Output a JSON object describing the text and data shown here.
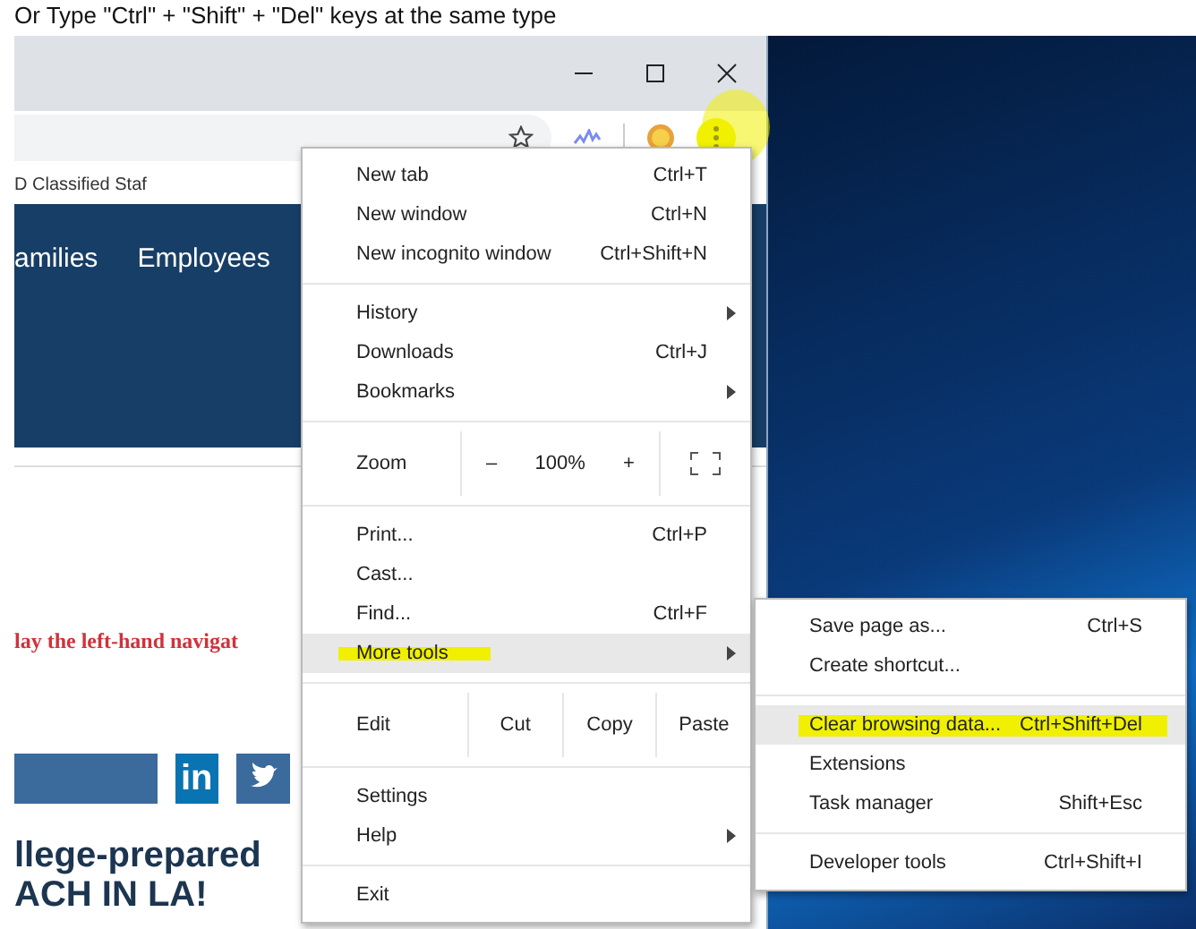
{
  "caption": "Or Type \"Ctrl\" + \"Shift\" + \"Del\" keys at the same type",
  "page": {
    "bookmark": "D Classified Staf",
    "nav": [
      "amilies",
      "Employees"
    ],
    "notice": "lay the left-hand navigat",
    "social": [
      "in"
    ],
    "heading": [
      "llege-prepared",
      "ACH IN LA!"
    ]
  },
  "menu": {
    "items": [
      {
        "kind": "item",
        "label": "New tab",
        "shortcut": "Ctrl+T",
        "submenu": false,
        "selected": false
      },
      {
        "kind": "item",
        "label": "New window",
        "shortcut": "Ctrl+N",
        "submenu": false,
        "selected": false
      },
      {
        "kind": "item",
        "label": "New incognito window",
        "shortcut": "Ctrl+Shift+N",
        "submenu": false,
        "selected": false
      },
      {
        "kind": "separator"
      },
      {
        "kind": "item",
        "label": "History",
        "submenu": true,
        "selected": false
      },
      {
        "kind": "item",
        "label": "Downloads",
        "shortcut": "Ctrl+J",
        "submenu": false,
        "selected": false
      },
      {
        "kind": "item",
        "label": "Bookmarks",
        "submenu": true,
        "selected": false
      },
      {
        "kind": "separator"
      },
      {
        "kind": "zoom",
        "label": "Zoom",
        "minus": "–",
        "value": "100%",
        "plus": "+"
      },
      {
        "kind": "separator"
      },
      {
        "kind": "item",
        "label": "Print...",
        "shortcut": "Ctrl+P",
        "submenu": false,
        "selected": false
      },
      {
        "kind": "item",
        "label": "Cast...",
        "submenu": false,
        "selected": false
      },
      {
        "kind": "item",
        "label": "Find...",
        "shortcut": "Ctrl+F",
        "submenu": false,
        "selected": false
      },
      {
        "kind": "item",
        "label": "More tools",
        "submenu": true,
        "selected": true,
        "highlighted": true
      },
      {
        "kind": "separator"
      },
      {
        "kind": "edit",
        "label": "Edit",
        "buttons": [
          "Cut",
          "Copy",
          "Paste"
        ]
      },
      {
        "kind": "separator"
      },
      {
        "kind": "item",
        "label": "Settings",
        "submenu": false,
        "selected": false
      },
      {
        "kind": "item",
        "label": "Help",
        "submenu": true,
        "selected": false
      },
      {
        "kind": "separator"
      },
      {
        "kind": "item",
        "label": "Exit",
        "submenu": false,
        "selected": false
      }
    ]
  },
  "submenu": {
    "items": [
      {
        "kind": "item",
        "label": "Save page as...",
        "shortcut": "Ctrl+S",
        "selected": false
      },
      {
        "kind": "item",
        "label": "Create shortcut...",
        "selected": false
      },
      {
        "kind": "separator"
      },
      {
        "kind": "item",
        "label": "Clear browsing data...",
        "shortcut": "Ctrl+Shift+Del",
        "selected": true,
        "highlighted": true
      },
      {
        "kind": "item",
        "label": "Extensions",
        "selected": false
      },
      {
        "kind": "item",
        "label": "Task manager",
        "shortcut": "Shift+Esc",
        "selected": false
      },
      {
        "kind": "separator"
      },
      {
        "kind": "item",
        "label": "Developer tools",
        "shortcut": "Ctrl+Shift+I",
        "selected": false
      }
    ]
  },
  "menu_button": {
    "highlighted": true
  }
}
